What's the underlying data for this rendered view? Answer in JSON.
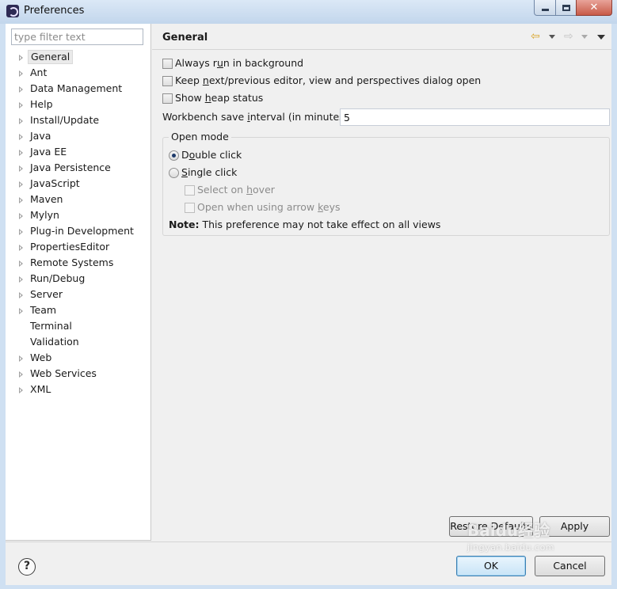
{
  "window": {
    "title": "Preferences"
  },
  "filter": {
    "placeholder": "type filter text",
    "value": ""
  },
  "tree": [
    {
      "label": "General",
      "expandable": true,
      "selected": true
    },
    {
      "label": "Ant",
      "expandable": true
    },
    {
      "label": "Data Management",
      "expandable": true
    },
    {
      "label": "Help",
      "expandable": true
    },
    {
      "label": "Install/Update",
      "expandable": true
    },
    {
      "label": "Java",
      "expandable": true
    },
    {
      "label": "Java EE",
      "expandable": true
    },
    {
      "label": "Java Persistence",
      "expandable": true
    },
    {
      "label": "JavaScript",
      "expandable": true
    },
    {
      "label": "Maven",
      "expandable": true
    },
    {
      "label": "Mylyn",
      "expandable": true
    },
    {
      "label": "Plug-in Development",
      "expandable": true
    },
    {
      "label": "PropertiesEditor",
      "expandable": true
    },
    {
      "label": "Remote Systems",
      "expandable": true
    },
    {
      "label": "Run/Debug",
      "expandable": true
    },
    {
      "label": "Server",
      "expandable": true
    },
    {
      "label": "Team",
      "expandable": true
    },
    {
      "label": "Terminal",
      "expandable": false
    },
    {
      "label": "Validation",
      "expandable": false
    },
    {
      "label": "Web",
      "expandable": true
    },
    {
      "label": "Web Services",
      "expandable": true
    },
    {
      "label": "XML",
      "expandable": true
    }
  ],
  "page": {
    "title": "General",
    "options": {
      "always_run_background": {
        "pre": "Always r",
        "mn": "u",
        "post": "n in background",
        "checked": false
      },
      "keep_next_previous": {
        "pre": "Keep ",
        "mn": "n",
        "post": "ext/previous editor, view and perspectives dialog open",
        "checked": false
      },
      "show_heap": {
        "pre": "Show ",
        "mn": "h",
        "post": "eap status",
        "checked": false
      }
    },
    "interval": {
      "pre": "Workbench save ",
      "mn": "i",
      "post": "nterval (in minutes):",
      "value": "5"
    },
    "open_mode": {
      "title": "Open mode",
      "double_click": {
        "pre": "D",
        "mn": "o",
        "post": "uble click",
        "selected": true
      },
      "single_click": {
        "pre": "",
        "mn": "S",
        "post": "ingle click",
        "selected": false
      },
      "select_on_hover": {
        "pre": "Select on ",
        "mn": "h",
        "post": "over",
        "checked": false,
        "enabled": false
      },
      "open_arrow_keys": {
        "pre": "Open when using arrow ",
        "mn": "k",
        "post": "eys",
        "checked": false,
        "enabled": false
      },
      "note_label": "Note:",
      "note_text": "This preference may not take effect on all views"
    }
  },
  "buttons": {
    "restore_defaults": "Restore Defaults",
    "apply": "Apply",
    "ok": "OK",
    "cancel": "Cancel",
    "help": "?"
  },
  "icons": {
    "back": "back-arrow-icon",
    "forward": "forward-arrow-icon",
    "view_menu": "view-menu-icon"
  },
  "colors": {
    "titlebar": "#c2d6ec",
    "close_button": "#c85a48",
    "default_button": "#3c7fb1",
    "back_arrow": "#d9a52a"
  },
  "watermark": {
    "brand": "Baidu经验",
    "url": "jingyan.baidu.com"
  }
}
